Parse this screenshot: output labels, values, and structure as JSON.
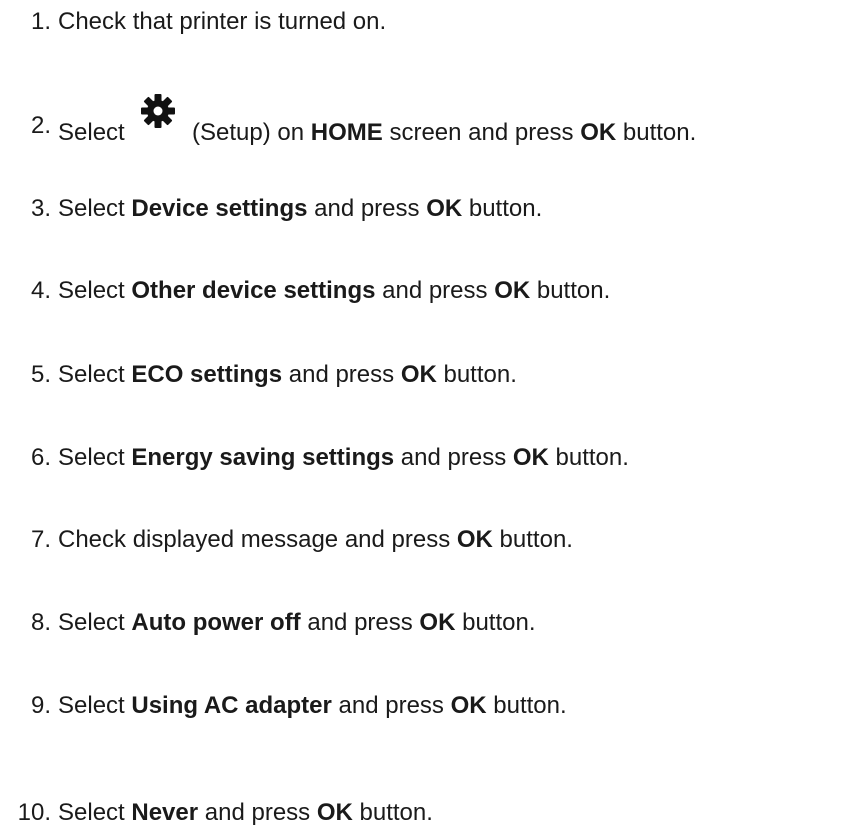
{
  "steps": [
    {
      "num": "1.",
      "parts": [
        {
          "t": "Check that printer is turned on."
        }
      ]
    },
    {
      "num": "2.",
      "parts": [
        {
          "t": "Select "
        },
        {
          "icon": "gear-icon"
        },
        {
          "t": " (Setup) on "
        },
        {
          "b": "HOME"
        },
        {
          "t": " screen and press "
        },
        {
          "b": "OK"
        },
        {
          "t": " button."
        }
      ]
    },
    {
      "num": "3.",
      "parts": [
        {
          "t": "Select "
        },
        {
          "b": "Device settings"
        },
        {
          "t": " and press "
        },
        {
          "b": "OK"
        },
        {
          "t": " button."
        }
      ]
    },
    {
      "num": "4.",
      "parts": [
        {
          "t": "Select "
        },
        {
          "b": "Other device settings"
        },
        {
          "t": " and press "
        },
        {
          "b": "OK"
        },
        {
          "t": " button."
        }
      ]
    },
    {
      "num": "5.",
      "parts": [
        {
          "t": "Select "
        },
        {
          "b": "ECO settings"
        },
        {
          "t": " and press "
        },
        {
          "b": "OK"
        },
        {
          "t": " button."
        }
      ]
    },
    {
      "num": "6.",
      "parts": [
        {
          "t": "Select "
        },
        {
          "b": "Energy saving settings"
        },
        {
          "t": " and press "
        },
        {
          "b": "OK"
        },
        {
          "t": " button."
        }
      ]
    },
    {
      "num": "7.",
      "parts": [
        {
          "t": "Check displayed message and press "
        },
        {
          "b": "OK"
        },
        {
          "t": " button."
        }
      ]
    },
    {
      "num": "8.",
      "parts": [
        {
          "t": "Select "
        },
        {
          "b": "Auto power off"
        },
        {
          "t": " and press "
        },
        {
          "b": "OK"
        },
        {
          "t": " button."
        }
      ]
    },
    {
      "num": "9.",
      "parts": [
        {
          "t": "Select "
        },
        {
          "b": "Using AC adapter"
        },
        {
          "t": " and press "
        },
        {
          "b": "OK"
        },
        {
          "t": " button."
        }
      ]
    },
    {
      "num": "10.",
      "parts": [
        {
          "t": "Select "
        },
        {
          "b": "Never"
        },
        {
          "t": " and press "
        },
        {
          "b": "OK"
        },
        {
          "t": " button."
        }
      ]
    }
  ]
}
